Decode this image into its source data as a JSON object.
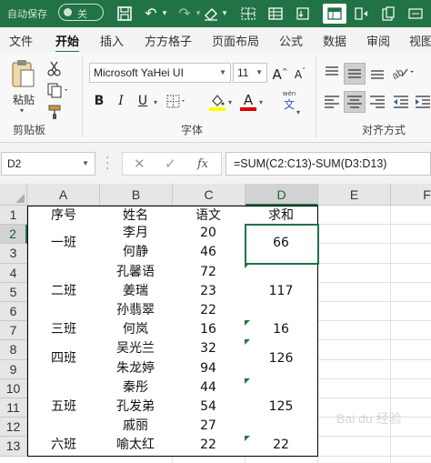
{
  "titlebar": {
    "autosave_label": "自动保存",
    "autosave_state": "关",
    "accent": "#217346"
  },
  "tabs": [
    {
      "label": "文件",
      "active": false
    },
    {
      "label": "开始",
      "active": true
    },
    {
      "label": "插入",
      "active": false
    },
    {
      "label": "方方格子",
      "active": false
    },
    {
      "label": "页面布局",
      "active": false
    },
    {
      "label": "公式",
      "active": false
    },
    {
      "label": "数据",
      "active": false
    },
    {
      "label": "审阅",
      "active": false
    },
    {
      "label": "视图",
      "active": false
    }
  ],
  "ribbon": {
    "clipboard": {
      "paste_label": "粘贴",
      "group_label": "剪贴板"
    },
    "font": {
      "font_name": "Microsoft YaHei UI",
      "font_size": "11",
      "bold": "B",
      "italic": "I",
      "underline": "U",
      "wen_label": "wén",
      "wen_char": "文",
      "grow_label": "A",
      "shrink_label": "A",
      "font_color_label": "A",
      "group_label": "字体",
      "highlight_color": "#ffff00",
      "font_color": "#e00000"
    },
    "alignment": {
      "group_label": "对齐方式"
    }
  },
  "formula_bar": {
    "name_box": "D2",
    "fx_label": "fx",
    "cancel_symbol": "✕",
    "enter_symbol": "✓",
    "formula": "=SUM(C2:C13)-SUM(D3:D13)"
  },
  "sheet": {
    "columns": [
      "A",
      "B",
      "C",
      "D",
      "E",
      "F"
    ],
    "selected_column": "D",
    "rows": [
      "1",
      "2",
      "3",
      "4",
      "5",
      "6",
      "7",
      "8",
      "9",
      "10",
      "11",
      "12",
      "13"
    ],
    "selected_row": "2",
    "header": {
      "A": "序号",
      "B": "姓名",
      "C": "语文",
      "D": "求和"
    },
    "groups": [
      {
        "class": "一班",
        "sum": "66",
        "students": [
          {
            "name": "李月",
            "score": "20"
          },
          {
            "name": "何静",
            "score": "46"
          }
        ]
      },
      {
        "class": "二班",
        "sum": "117",
        "students": [
          {
            "name": "孔馨语",
            "score": "72"
          },
          {
            "name": "姜瑞",
            "score": "23"
          },
          {
            "name": "孙翡翠",
            "score": "22"
          }
        ]
      },
      {
        "class": "三班",
        "sum": "16",
        "students": [
          {
            "name": "何岚",
            "score": "16"
          }
        ]
      },
      {
        "class": "四班",
        "sum": "126",
        "students": [
          {
            "name": "吴光兰",
            "score": "32"
          },
          {
            "name": "朱龙婷",
            "score": "94"
          }
        ]
      },
      {
        "class": "五班",
        "sum": "125",
        "students": [
          {
            "name": "秦彤",
            "score": "44"
          },
          {
            "name": "孔发弟",
            "score": "54"
          },
          {
            "name": "戚丽",
            "score": "27"
          }
        ]
      },
      {
        "class": "六班",
        "sum": "22",
        "students": [
          {
            "name": "喻太红",
            "score": "22"
          }
        ]
      }
    ]
  },
  "watermark": "Bai du 经验"
}
